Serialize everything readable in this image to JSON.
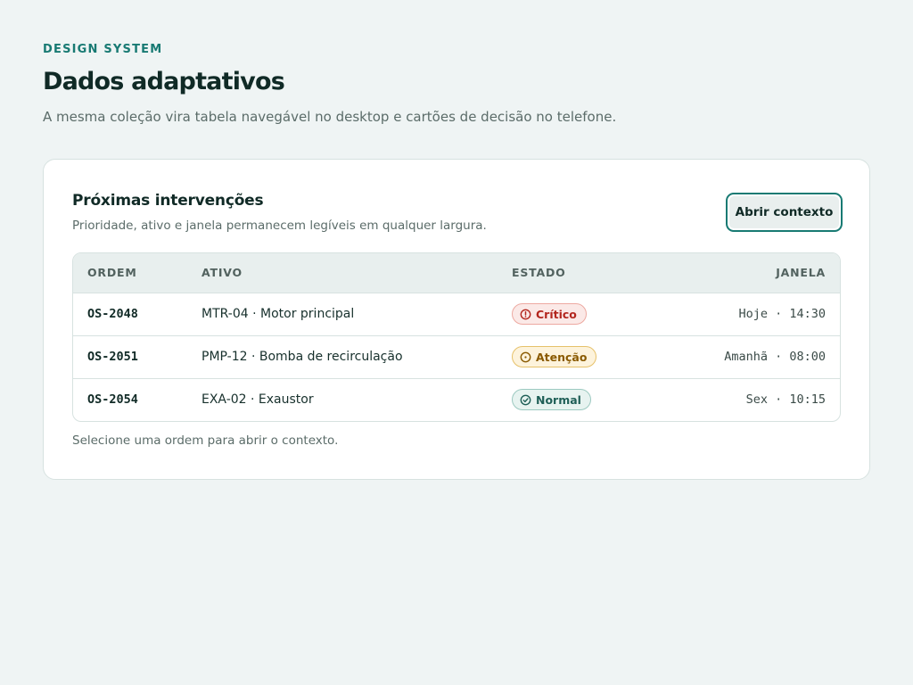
{
  "header": {
    "eyebrow": "DESIGN SYSTEM",
    "title": "Dados adaptativos",
    "subtitle": "A mesma coleção vira tabela navegável no desktop e cartões de decisão no telefone."
  },
  "card": {
    "title": "Próximas intervenções",
    "description": "Prioridade, ativo e janela permanecem legíveis em qualquer largura.",
    "button_label": "Abrir contexto",
    "footnote": "Selecione uma ordem para abrir o contexto."
  },
  "table": {
    "columns": {
      "order": "ORDEM",
      "asset": "ATIVO",
      "status": "ESTADO",
      "window": "JANELA"
    },
    "rows": [
      {
        "order": "OS-2048",
        "asset": "MTR-04 · Motor principal",
        "status": "Crítico",
        "status_icon": "alert-icon",
        "status_fg": "#b3261e",
        "status_bg": "#fbe9e7",
        "status_border": "#eda9a1",
        "window": "Hoje · 14:30"
      },
      {
        "order": "OS-2051",
        "asset": "PMP-12 · Bomba de recirculação",
        "status": "Atenção",
        "status_icon": "clock-icon",
        "status_fg": "#8a5a00",
        "status_bg": "#fdf3dc",
        "status_border": "#e6c16a",
        "window": "Amanhã · 08:00"
      },
      {
        "order": "OS-2054",
        "asset": "EXA-02 · Exaustor",
        "status": "Normal",
        "status_icon": "check-circle-icon",
        "status_fg": "#1f5f57",
        "status_bg": "#e7f3f0",
        "status_border": "#9cc9c0",
        "window": "Sex · 10:15"
      }
    ]
  }
}
